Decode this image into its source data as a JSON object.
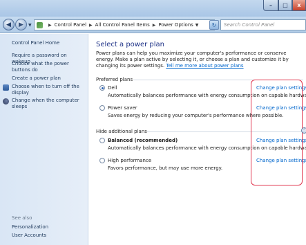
{
  "window": {
    "controls": {
      "minimize": "–",
      "maximize": "□",
      "close": "x"
    }
  },
  "address_bar": {
    "breadcrumb": [
      "Control Panel",
      "All Control Panel Items",
      "Power Options"
    ],
    "search_placeholder": "Search Control Panel"
  },
  "sidebar": {
    "home": "Control Panel Home",
    "links": [
      "Require a password on wakeup",
      "Choose what the power buttons do",
      "Create a power plan",
      "Choose when to turn off the display",
      "Change when the computer sleeps"
    ],
    "see_also_title": "See also",
    "see_also_links": [
      "Personalization",
      "User Accounts"
    ]
  },
  "main": {
    "title": "Select a power plan",
    "intro": "Power plans can help you maximize your computer's performance or conserve energy. Make a plan active by selecting it, or choose a plan and customize it by changing its power settings.",
    "intro_link": "Tell me more about power plans",
    "preferred_label": "Preferred plans",
    "additional_label": "Hide additional plans",
    "change_link_label": "Change plan settings",
    "plans": [
      {
        "name": "Dell",
        "description": "Automatically balances performance with energy consumption on capable hardware.",
        "selected": true
      },
      {
        "name": "Power saver",
        "description": "Saves energy by reducing your computer's performance where possible.",
        "selected": false
      },
      {
        "name": "Balanced (recommended)",
        "description": "Automatically balances performance with energy consumption on capable hardware.",
        "selected": false
      },
      {
        "name": "High performance",
        "description": "Favors performance, but may use more energy.",
        "selected": false
      }
    ]
  },
  "colors": {
    "link": "#0066cc",
    "heading": "#1e3287",
    "highlight": "#e0324b"
  }
}
